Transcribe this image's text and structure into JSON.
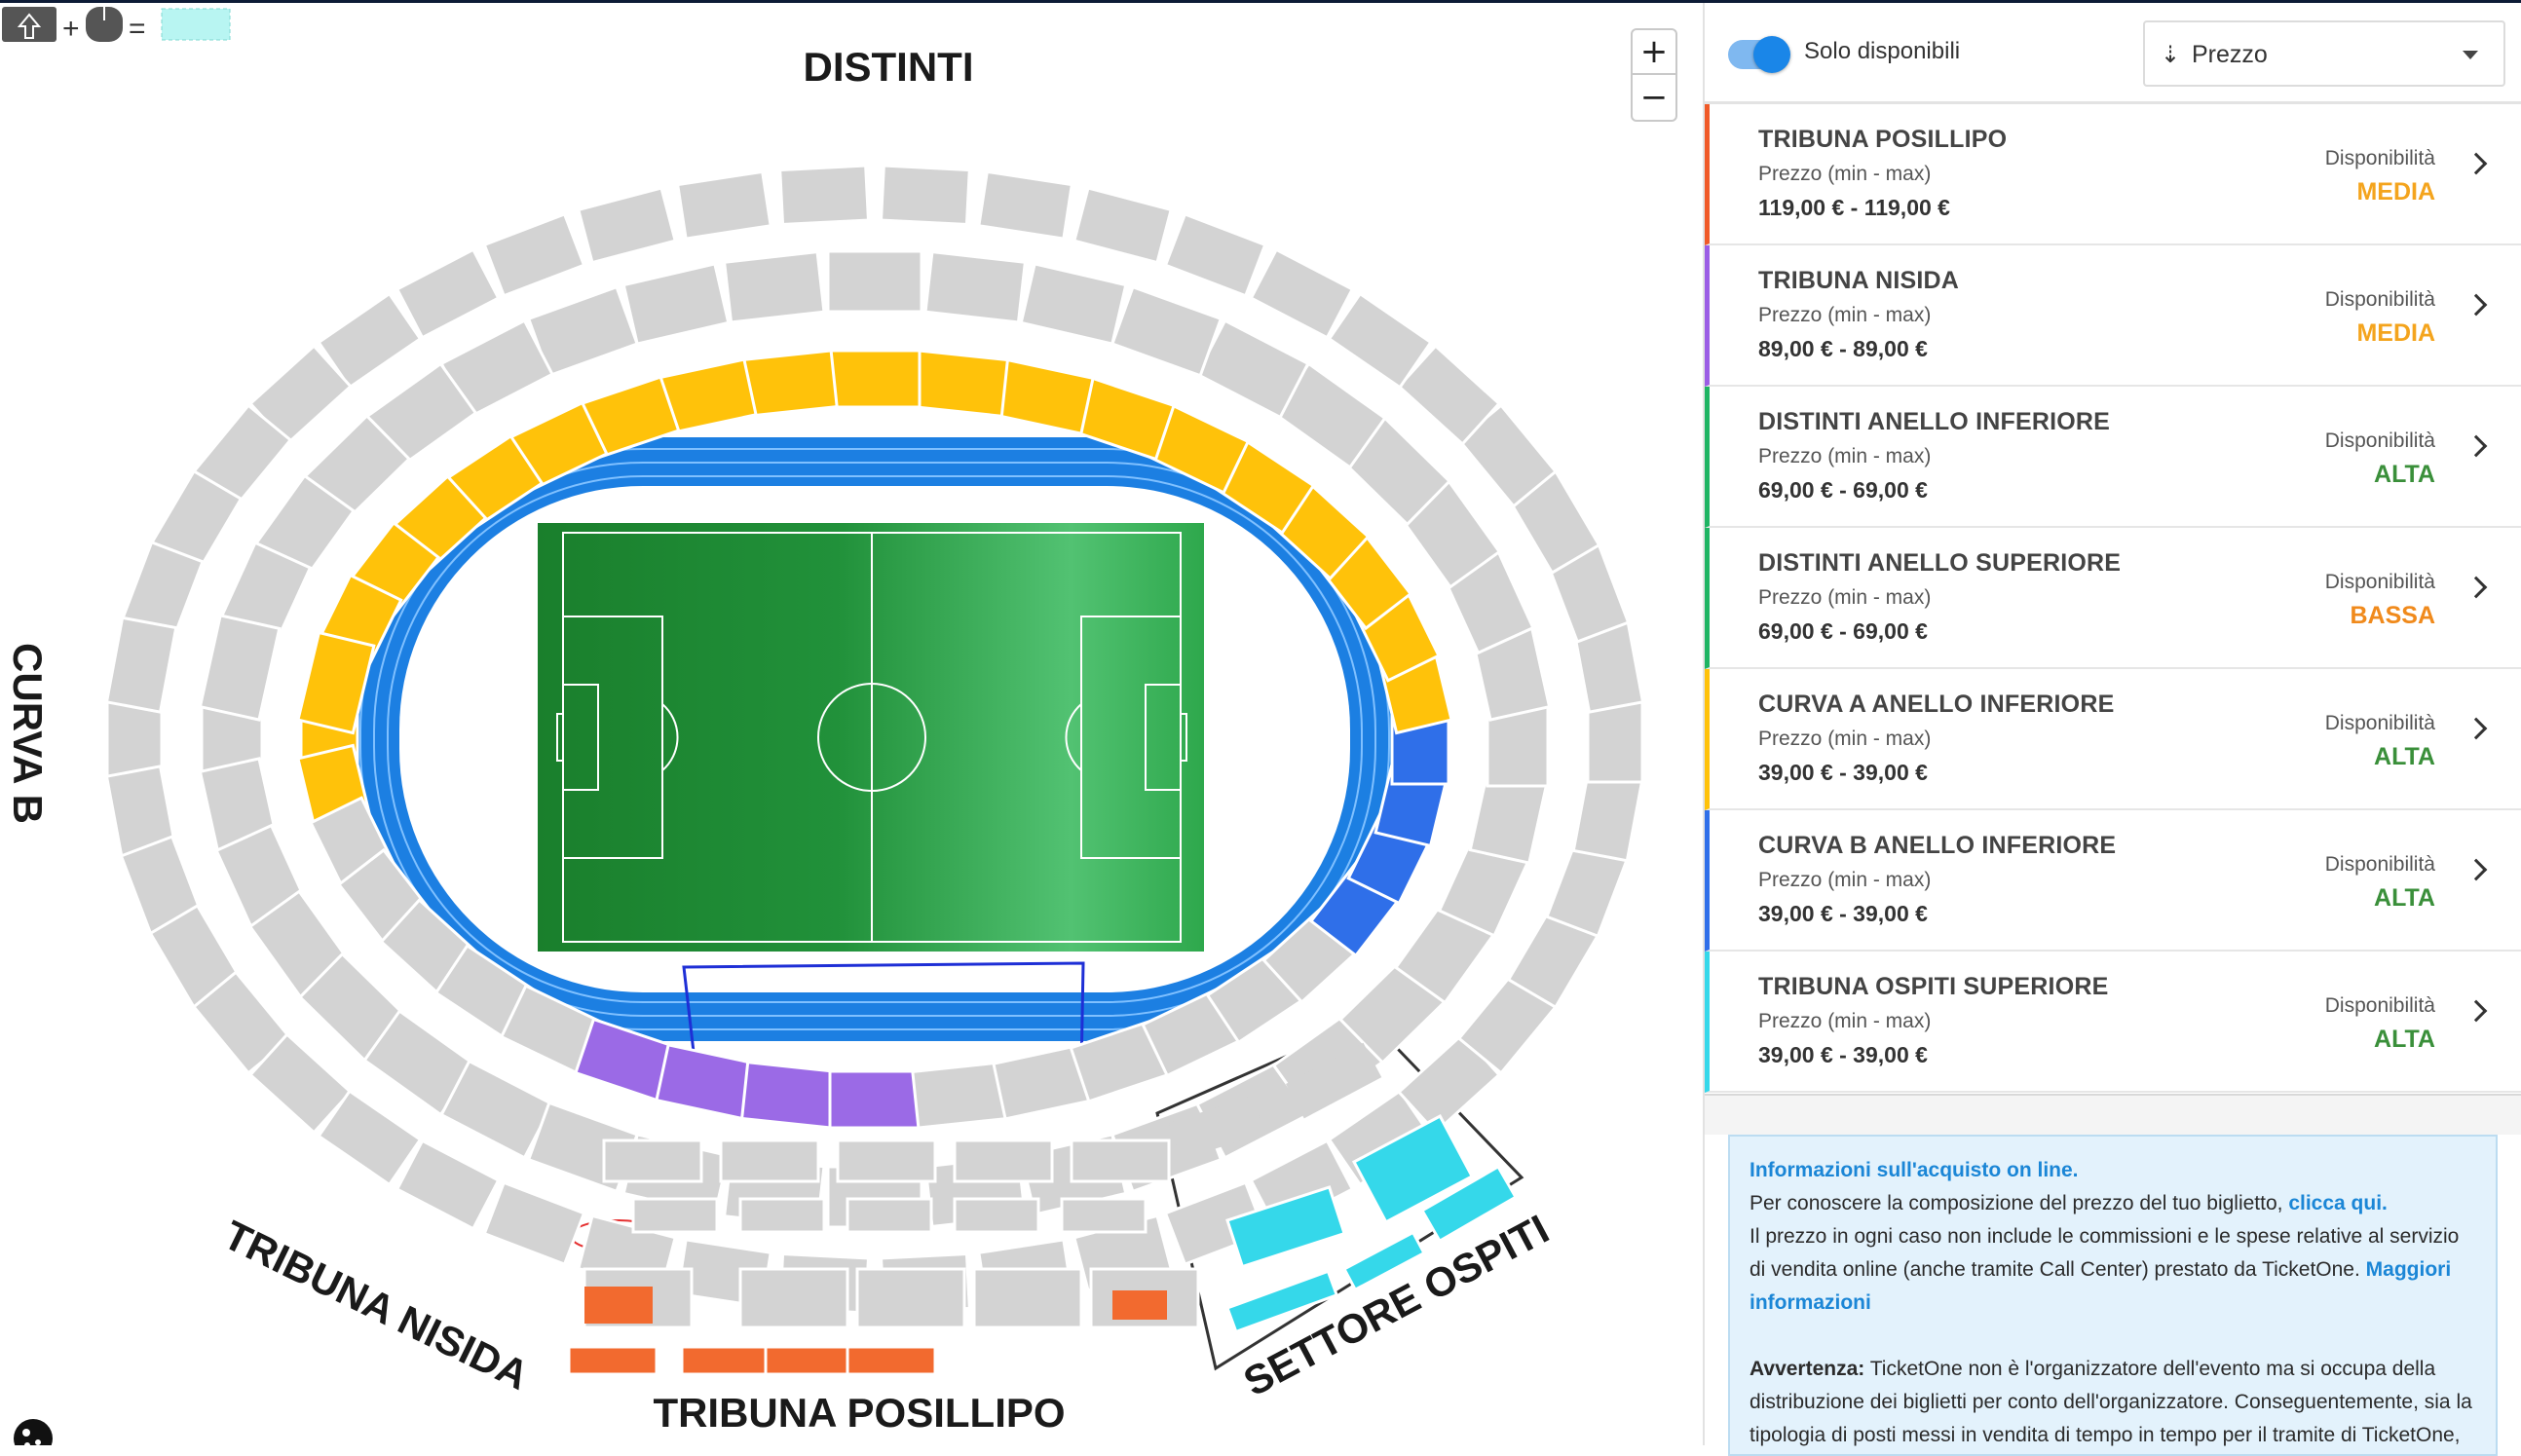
{
  "map": {
    "labels": {
      "distinti": "DISTINTI",
      "curva_b": "CURVA B",
      "tribuna_nisida": "TRIBUNA NISIDA",
      "tribuna_posillipo": "TRIBUNA POSILLIPO",
      "settore_ospiti": "SETTORE OSPITI"
    },
    "zoom_in": "+",
    "zoom_out": "−",
    "colors": {
      "track": "#1c7fe2",
      "pitch": "#1e8a32",
      "unavailable": "#d3d3d3",
      "green_sectors": "#1fb463",
      "blue_sectors": "#2f6fe9",
      "yellow_sectors": "#ffc20a",
      "purple_sectors": "#9b6ae6",
      "orange_sectors": "#f26a2f",
      "cyan_sectors": "#35d8ea"
    }
  },
  "panel": {
    "filter": {
      "toggle_label": "Solo disponibili",
      "toggle_on": true,
      "sort_icon": "sort-descending-icon",
      "sort_value": "Prezzo"
    },
    "sectors": [
      {
        "name": "TRIBUNA POSILLIPO",
        "price_label": "Prezzo (min - max)",
        "price": "119,00 € - 119,00 €",
        "avail_label": "Disponibilità",
        "avail": "MEDIA",
        "avail_color": "#f4a41d",
        "accent": "#f05a28"
      },
      {
        "name": "TRIBUNA NISIDA",
        "price_label": "Prezzo (min - max)",
        "price": "89,00 € - 89,00 €",
        "avail_label": "Disponibilità",
        "avail": "MEDIA",
        "avail_color": "#f4a41d",
        "accent": "#9b5de5"
      },
      {
        "name": "DISTINTI ANELLO INFERIORE",
        "price_label": "Prezzo (min - max)",
        "price": "69,00 € - 69,00 €",
        "avail_label": "Disponibilità",
        "avail": "ALTA",
        "avail_color": "#3a8f3a",
        "accent": "#1fb463"
      },
      {
        "name": "DISTINTI ANELLO SUPERIORE",
        "price_label": "Prezzo (min - max)",
        "price": "69,00 € - 69,00 €",
        "avail_label": "Disponibilità",
        "avail": "BASSA",
        "avail_color": "#f08a1c",
        "accent": "#1fb463"
      },
      {
        "name": "CURVA A ANELLO INFERIORE",
        "price_label": "Prezzo (min - max)",
        "price": "39,00 € - 39,00 €",
        "avail_label": "Disponibilità",
        "avail": "ALTA",
        "avail_color": "#3a8f3a",
        "accent": "#ffc20a"
      },
      {
        "name": "CURVA B ANELLO INFERIORE",
        "price_label": "Prezzo (min - max)",
        "price": "39,00 € - 39,00 €",
        "avail_label": "Disponibilità",
        "avail": "ALTA",
        "avail_color": "#3a8f3a",
        "accent": "#2f6fe9"
      },
      {
        "name": "TRIBUNA OSPITI SUPERIORE",
        "price_label": "Prezzo (min - max)",
        "price": "39,00 € - 39,00 €",
        "avail_label": "Disponibilità",
        "avail": "ALTA",
        "avail_color": "#3a8f3a",
        "accent": "#35d8ea"
      }
    ],
    "info": {
      "title": "Informazioni sull'acquisto on line.",
      "line1": "Per conoscere la composizione del prezzo del tuo biglietto,",
      "link1": "clicca qui.",
      "line2": "Il prezzo in ogni caso non include le commissioni e le spese relative al servizio di vendita online (anche tramite Call Center) prestato da TicketOne.",
      "link2": "Maggiori informazioni",
      "warn_title": "Avvertenza:",
      "warn_text": "TicketOne non è l'organizzatore dell'evento ma si occupa della distribuzione dei biglietti per conto dell'organizzatore. Conseguentemente, sia la tipologia di posti messi in vendita di tempo in tempo per il tramite di TicketOne,"
    }
  }
}
